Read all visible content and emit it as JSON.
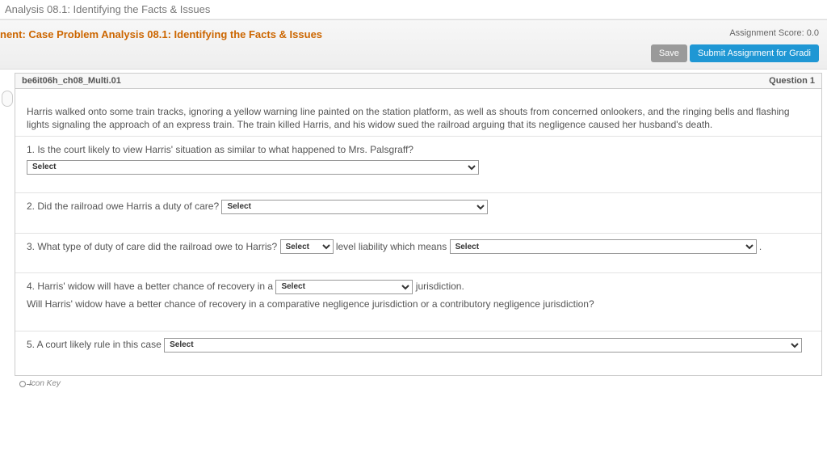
{
  "breadcrumb": "Analysis 08.1: Identifying the Facts & Issues",
  "assignment": {
    "title": "nent: Case Problem Analysis 08.1: Identifying the Facts & Issues",
    "score_label": "Assignment Score: 0.0",
    "save_label": "Save",
    "submit_label": "Submit Assignment for Gradi"
  },
  "question": {
    "id_label": "be6it06h_ch08_Multi.01",
    "number_label": "Question 1",
    "scenario": "Harris walked onto some train tracks, ignoring a yellow warning line painted on the station platform, as well as shouts from concerned onlookers, and the ringing bells and flashing lights signaling the approach of an express train. The train killed Harris, and his widow sued the railroad arguing that its negligence caused her husband's death."
  },
  "dropdown_placeholder": "Select",
  "q1": {
    "text": "1. Is the court likely to view Harris' situation as similar to what happened to Mrs. Palsgraff? "
  },
  "q2": {
    "text": "2. Did the railroad owe Harris a duty of care? "
  },
  "q3": {
    "pre": "3. What type of duty of care did the railroad owe to Harris? ",
    "mid": " level liability which means ",
    "post": " ."
  },
  "q4": {
    "pre": "4. Harris' widow will have a better chance of recovery in a ",
    "post": " jurisdiction.",
    "sub": "Will Harris' widow have a better chance of recovery in a comparative negligence jurisdiction or a contributory negligence jurisdiction?"
  },
  "q5": {
    "text": "5. A court likely rule in this case "
  },
  "footer": {
    "icon_key": "Icon Key"
  }
}
